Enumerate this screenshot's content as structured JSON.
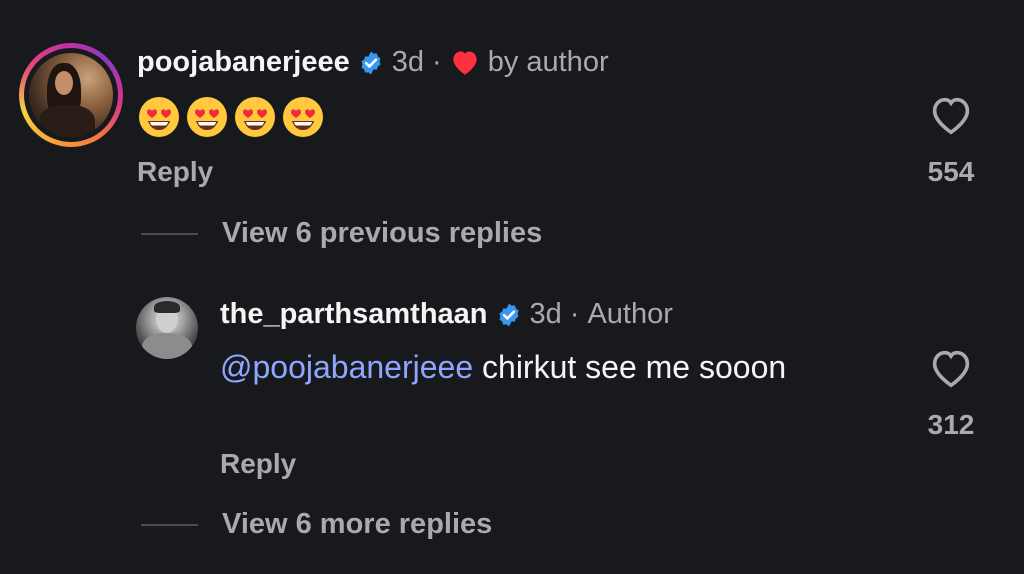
{
  "comment": {
    "username": "poojabanerjeee",
    "age": "3d",
    "separator": "·",
    "author_like_label": "by author",
    "emojis": [
      "heart-eyes-emoji",
      "heart-eyes-emoji",
      "heart-eyes-emoji",
      "heart-eyes-emoji"
    ],
    "reply_label": "Reply",
    "like_count": "554",
    "view_previous_replies": "View 6 previous replies"
  },
  "reply": {
    "username": "the_parthsamthaan",
    "age": "3d",
    "separator": "·",
    "author_badge": "Author",
    "mention": "@poojabanerjeee",
    "text": " chirkut see me sooon",
    "reply_label": "Reply",
    "like_count": "312",
    "view_more_replies": "View 6 more replies"
  },
  "colors": {
    "background": "#18191c",
    "primary_text": "#f5f5f5",
    "secondary_text": "#a8aaae",
    "mention": "#8fa6ff",
    "verified_badge": "#3897f0",
    "liked_heart": "#ff3040"
  }
}
